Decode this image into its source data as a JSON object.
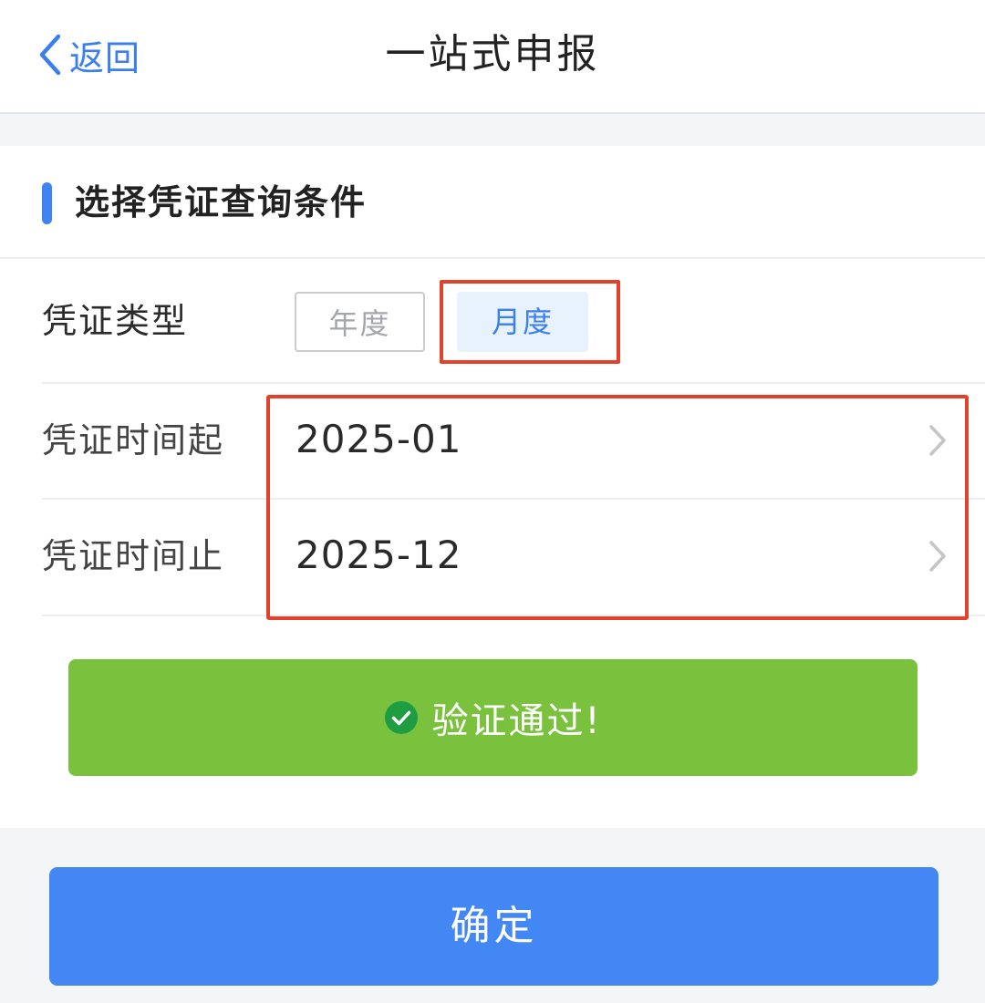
{
  "nav": {
    "back_label": "返回",
    "title": "一站式申报"
  },
  "section": {
    "title": "选择凭证查询条件"
  },
  "form": {
    "type_label": "凭证类型",
    "type_options": [
      "年度",
      "月度"
    ],
    "type_selected": "月度",
    "start_label": "凭证时间起",
    "start_value": "2025-01",
    "end_label": "凭证时间止",
    "end_value": "2025-12"
  },
  "status": {
    "text": "验证通过!"
  },
  "actions": {
    "confirm_label": "确定"
  },
  "colors": {
    "accent": "#3a7ff0",
    "success": "#7ac23d",
    "highlight": "#e2412c",
    "primary_button": "#4287f4"
  },
  "icons": {
    "back": "chevron-left-icon",
    "row_arrow": "chevron-right-icon",
    "status": "check-circle-icon"
  }
}
